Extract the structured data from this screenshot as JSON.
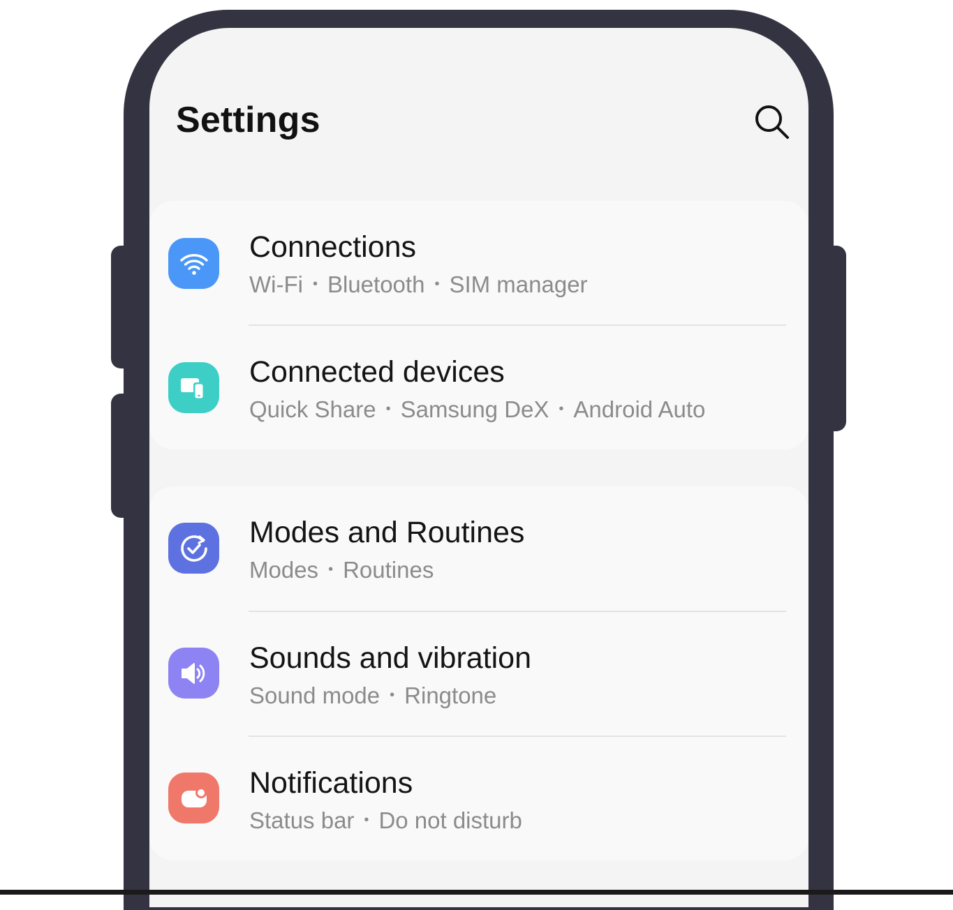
{
  "header": {
    "title": "Settings",
    "search_icon": "search-icon"
  },
  "colors": {
    "frame": "#343341",
    "screen_bg": "#f4f4f4",
    "card_bg": "#f9f9f9",
    "connections": "#4a97f7",
    "connected_devices": "#3dcfc6",
    "modes_routines": "#5d72e0",
    "sounds": "#8e83f2",
    "notifications": "#f0786a"
  },
  "settings": {
    "connections": {
      "title": "Connections",
      "icon": "wifi-icon",
      "subs": [
        "Wi-Fi",
        "Bluetooth",
        "SIM manager"
      ]
    },
    "connected_devices": {
      "title": "Connected devices",
      "icon": "devices-icon",
      "subs": [
        "Quick Share",
        "Samsung DeX",
        "Android Auto"
      ]
    },
    "modes_routines": {
      "title": "Modes and Routines",
      "icon": "check-circle-icon",
      "subs": [
        "Modes",
        "Routines"
      ]
    },
    "sounds": {
      "title": "Sounds and vibration",
      "icon": "speaker-icon",
      "subs": [
        "Sound mode",
        "Ringtone"
      ]
    },
    "notifications": {
      "title": "Notifications",
      "icon": "notification-icon",
      "subs": [
        "Status bar",
        "Do not disturb"
      ]
    }
  },
  "separator": "•"
}
